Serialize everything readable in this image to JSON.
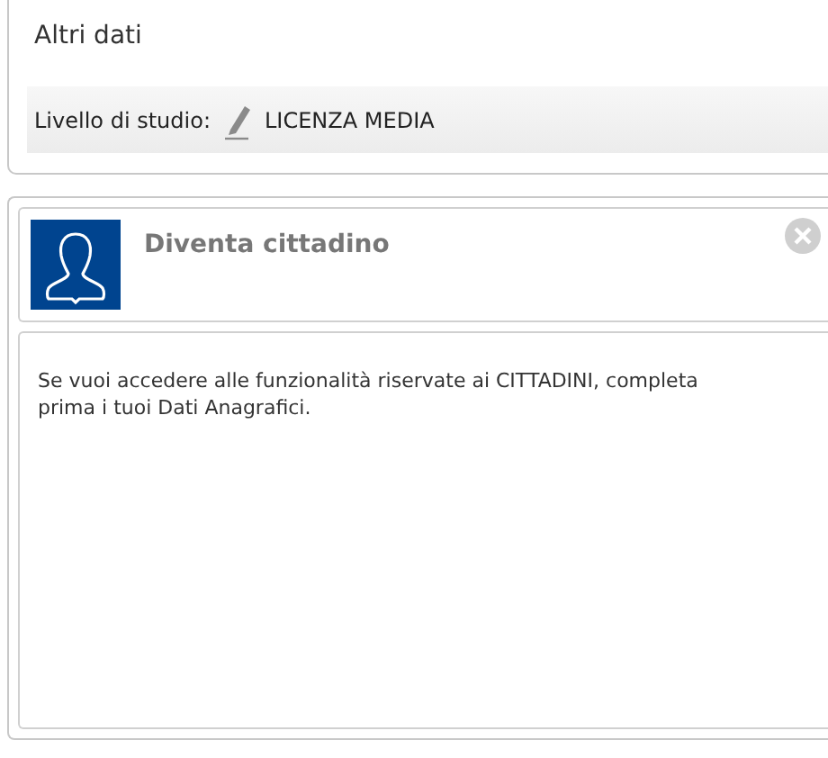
{
  "other_data": {
    "title": "Altri dati",
    "field_label": "Livello di studio:",
    "field_value": "LICENZA MEDIA"
  },
  "become_citizen": {
    "title": "Diventa cittadino",
    "message": "Se vuoi accedere alle funzionalità riservate ai CITTADINI, completa prima i tuoi Dati Anagrafici."
  }
}
